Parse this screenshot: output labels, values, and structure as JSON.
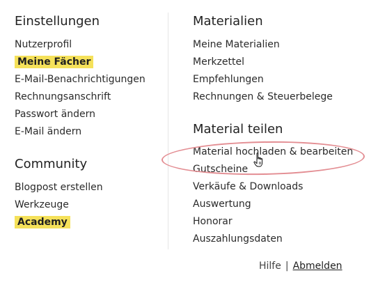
{
  "settings": {
    "heading": "Einstellungen",
    "items": [
      "Nutzerprofil",
      "Meine Fächer",
      "E-Mail-Benachrichtigungen",
      "Rechnungsanschrift",
      "Passwort ändern",
      "E-Mail ändern"
    ]
  },
  "community": {
    "heading": "Community",
    "items": [
      "Blogpost erstellen",
      "Werkzeuge",
      "Academy"
    ]
  },
  "materials": {
    "heading": "Materialien",
    "items": [
      "Meine Materialien",
      "Merkzettel",
      "Empfehlungen",
      "Rechnungen & Steuerbelege"
    ]
  },
  "share": {
    "heading": "Material teilen",
    "items": [
      "Material hochladen & bearbeiten",
      "Gutscheine",
      "Verkäufe & Downloads",
      "Auswertung",
      "Honorar",
      "Auszahlungsdaten"
    ]
  },
  "footer": {
    "help": "Hilfe",
    "separator": "|",
    "logout": "Abmelden"
  },
  "colors": {
    "highlight": "#f5e15a",
    "annotation_oval": "#e38d92"
  },
  "icons": {
    "cursor": "hand-pointer-icon"
  }
}
